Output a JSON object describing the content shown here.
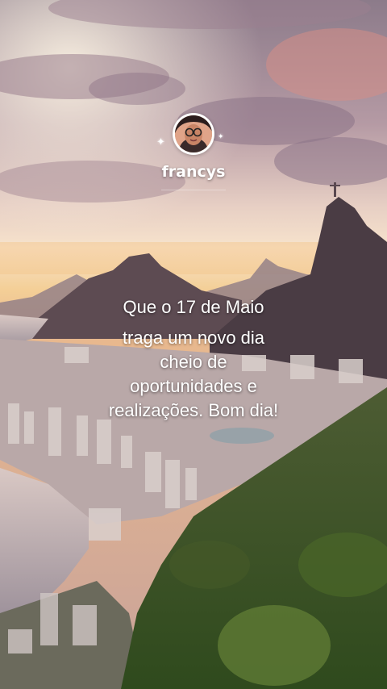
{
  "profile": {
    "username": "francys",
    "avatar_icon": "profile-photo"
  },
  "message": {
    "line1": "Que o 17 de Maio",
    "line2": "traga um novo dia",
    "line3": "cheio de",
    "line4": "oportunidades e",
    "line5": "realizações. Bom dia!"
  },
  "colors": {
    "sky_top": "#8f7f8d",
    "sky_glow": "#f6d6b0",
    "horizon": "#f2c98e",
    "mountain": "#4f4048",
    "water": "#b9aeb4",
    "vegetation": "#3f5a2a",
    "text": "#ffffff"
  }
}
